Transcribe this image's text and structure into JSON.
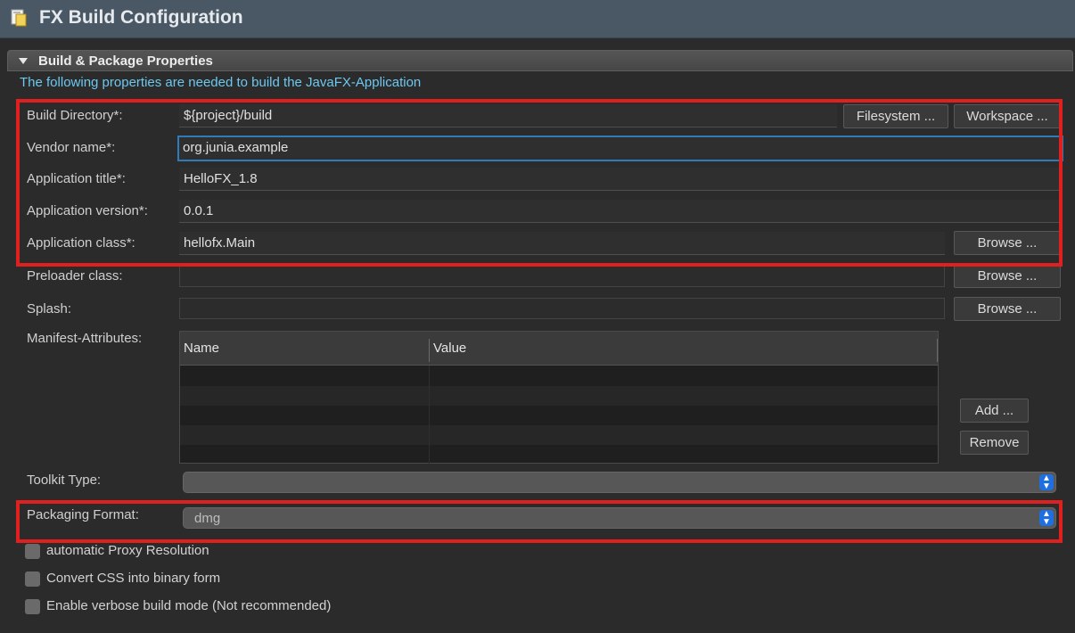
{
  "window": {
    "title": "FX Build Configuration",
    "icon": "document-icon"
  },
  "section": {
    "title": "Build & Package Properties",
    "description": "The following properties are needed to build the JavaFX-Application"
  },
  "fields": {
    "build_dir": {
      "label": "Build Directory*:",
      "value": "${project}/build"
    },
    "vendor": {
      "label": "Vendor name*:",
      "value": "org.junia.example"
    },
    "app_title": {
      "label": "Application title*:",
      "value": "HelloFX_1.8"
    },
    "app_version": {
      "label": "Application version*:",
      "value": "0.0.1"
    },
    "app_class": {
      "label": "Application class*:",
      "value": "hellofx.Main"
    },
    "preloader": {
      "label": "Preloader class:",
      "value": ""
    },
    "splash": {
      "label": "Splash:",
      "value": ""
    }
  },
  "buttons": {
    "filesystem": "Filesystem ...",
    "workspace": "Workspace ...",
    "browse": "Browse ...",
    "add": "Add ...",
    "remove": "Remove"
  },
  "manifest": {
    "label": "Manifest-Attributes:",
    "columns": [
      "Name",
      "Value"
    ],
    "rows": []
  },
  "toolkit": {
    "label": "Toolkit Type:",
    "value": ""
  },
  "packaging": {
    "label": "Packaging Format:",
    "value": "dmg"
  },
  "checkboxes": [
    {
      "label": "automatic Proxy Resolution",
      "checked": false
    },
    {
      "label": "Convert CSS into binary form",
      "checked": false
    },
    {
      "label": "Enable verbose build mode (Not recommended)",
      "checked": false
    }
  ],
  "colors": {
    "highlight": "#e01f1f",
    "accent": "#1f6fe0",
    "description_text": "#6cc8f0"
  }
}
